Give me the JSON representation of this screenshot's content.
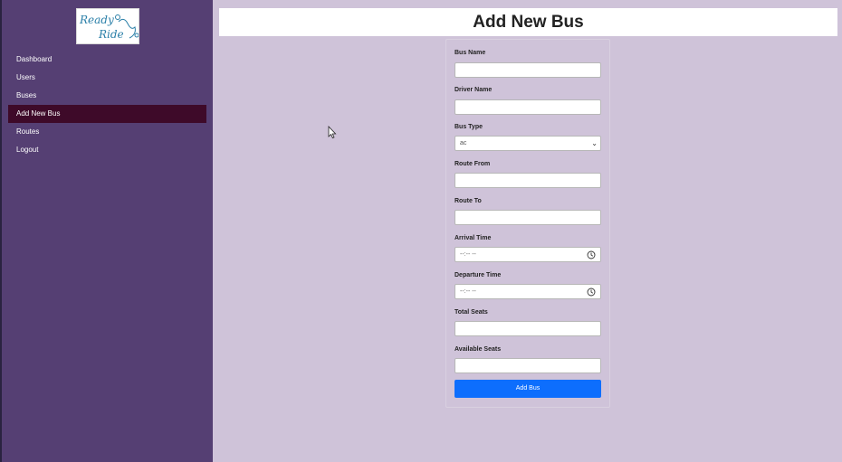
{
  "sidebar": {
    "logo": {
      "line1": "Ready",
      "line2": "Ride"
    },
    "items": [
      {
        "label": "Dashboard"
      },
      {
        "label": "Users"
      },
      {
        "label": "Buses"
      },
      {
        "label": "Add New Bus",
        "active": true
      },
      {
        "label": "Routes"
      },
      {
        "label": "Logout"
      }
    ]
  },
  "header": {
    "title": "Add New Bus"
  },
  "form": {
    "bus_name_label": "Bus Name",
    "driver_name_label": "Driver Name",
    "bus_type_label": "Bus Type",
    "bus_type_value": "ac",
    "route_from_label": "Route From",
    "route_to_label": "Route To",
    "arrival_time_label": "Arrival Time",
    "arrival_time_placeholder": "--:-- --",
    "departure_time_label": "Departure Time",
    "departure_time_placeholder": "--:-- --",
    "total_seats_label": "Total Seats",
    "available_seats_label": "Available Seats",
    "submit_label": "Add Bus"
  },
  "colors": {
    "sidebar_bg": "#553f73",
    "active_item_bg": "#3e0a29",
    "page_bg": "#cfc3d9",
    "button_bg": "#0d6efd"
  }
}
